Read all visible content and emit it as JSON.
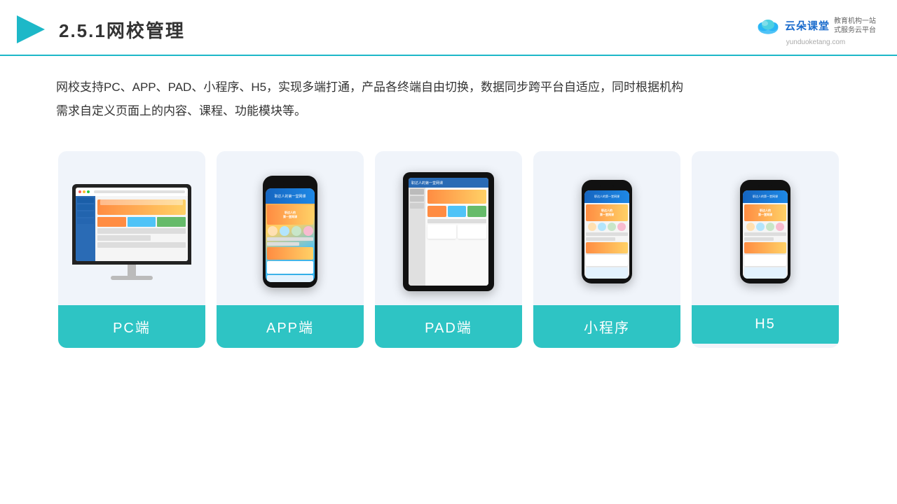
{
  "header": {
    "title_number": "2.5.1",
    "title_text": "网校管理",
    "logo_cn": "云朵课堂",
    "logo_url": "yunduoketang.com",
    "logo_tag_line1": "教育机构一站",
    "logo_tag_line2": "式服务云平台"
  },
  "description": {
    "line1": "网校支持PC、APP、PAD、小程序、H5，实现多端打通，产品各终端自由切换，数据同步跨平台自适应，同时根据机构",
    "line2": "需求自定义页面上的内容、课程、功能模块等。"
  },
  "cards": [
    {
      "id": "pc",
      "label": "PC端",
      "type": "monitor"
    },
    {
      "id": "app",
      "label": "APP端",
      "type": "phone"
    },
    {
      "id": "pad",
      "label": "PAD端",
      "type": "tablet"
    },
    {
      "id": "miniprogram",
      "label": "小程序",
      "type": "mini-phone"
    },
    {
      "id": "h5",
      "label": "H5",
      "type": "mini-phone2"
    }
  ],
  "accent_color": "#2ec4c4",
  "divider_color": "#1db8c8"
}
